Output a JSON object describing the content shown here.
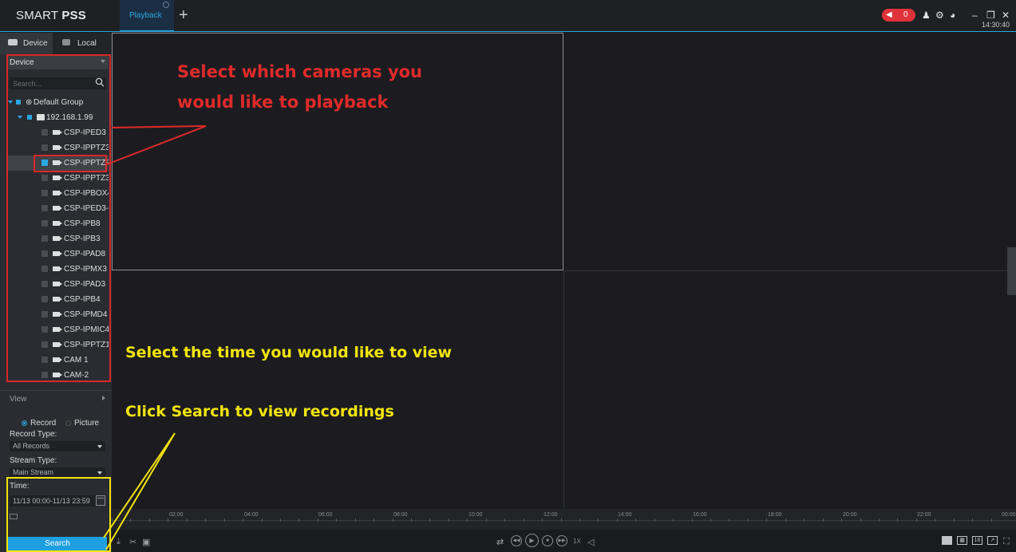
{
  "app": {
    "title_light": "SMART ",
    "title_bold": "PSS",
    "tab_label": "Playback",
    "add_tab": "+",
    "clock": "14:30:40",
    "alarm_count": "0"
  },
  "sidebar": {
    "tab_device": "Device",
    "tab_local": "Local",
    "device_dropdown": "Device",
    "search_placeholder": "Search...",
    "tree": {
      "group": "Default Group",
      "device": "192.168.1.99",
      "channels": [
        "CSP-IPED3",
        "CSP-IPPTZ30",
        "CSP-IPPTZF",
        "CSP-IPPTZ30",
        "CSP-IPBOX4",
        "CSP-IPED3-E",
        "CSP-IPB8",
        "CSP-IPB3",
        "CSP-IPAD8",
        "CSP-IPMX3",
        "CSP-IPAD3",
        "CSP-IPB4",
        "CSP-IPMD4",
        "CSP-IPMIC4",
        "CSP-IPPTZ12",
        "CAM 1",
        "CAM-2"
      ],
      "checked_index": 2
    },
    "view_label": "View",
    "record_radio": "Record",
    "picture_radio": "Picture",
    "record_type_label": "Record Type:",
    "record_type_value": "All Records",
    "stream_type_label": "Stream Type:",
    "stream_type_value": "Main Stream",
    "time_label": "Time:",
    "time_value": "11/13 00:00-11/13 23:59",
    "search_button": "Search"
  },
  "timeline": {
    "labels": [
      "02:00",
      "04:00",
      "06:00",
      "08:00",
      "10:00",
      "12:00",
      "14:00",
      "16:00",
      "18:00",
      "20:00",
      "22:00",
      "00:00"
    ]
  },
  "controls": {
    "speed": "1X",
    "layout_16": "16"
  },
  "annotations": {
    "red_line1": "Select which cameras you",
    "red_line2": "would like to playback",
    "yellow_time": "Select the time you would like to view",
    "yellow_search": "Click Search to view recordings"
  },
  "colors": {
    "accent": "#2aa7e0",
    "annotation_red": "#e02a2a",
    "annotation_yellow": "#f2e40c"
  }
}
